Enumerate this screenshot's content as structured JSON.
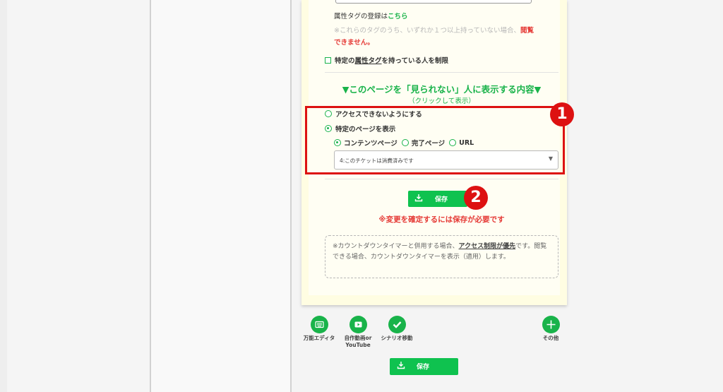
{
  "attr": {
    "prefix": "属性タグの登録は",
    "link": "こちら"
  },
  "note1": {
    "text": "※これらのタグのうち、いずれか１つ以上持っていない場合、",
    "red1": "閲覧",
    "red2": "できません。"
  },
  "restrict": {
    "pre": "特定の",
    "link": "属性タグ",
    "post": "を持っている人を制限"
  },
  "section": {
    "title": "▼このページを「見られない」人に表示する内容▼",
    "subtitle": "（クリックして表示）"
  },
  "radios": {
    "no_access": "アクセスできないようにする",
    "show_page": "特定のページを表示"
  },
  "subradios": {
    "content": "コンテンツページ",
    "complete": "完了ページ",
    "url": "URL"
  },
  "select": {
    "value": "4:このチケットは消費済みです"
  },
  "save": {
    "label": "保存",
    "warning": "※変更を確定するには保存が必要です"
  },
  "info": {
    "p1": "※カウントダウンタイマーと併用する場合、",
    "p2": "アクセス制限が優先",
    "p3": "です。閲覧できる場合、カウントダウンタイマーを表示（適用）します。"
  },
  "tools": {
    "editor": "万能エディタ",
    "video1": "自作動画or",
    "video2": "YouTube",
    "scenario": "シナリオ移動",
    "other": "その他"
  },
  "badges": {
    "one": "1",
    "two": "2"
  },
  "colors": {
    "accent": "#19b34a",
    "warning": "#e53935",
    "annotation": "#dd1111"
  }
}
